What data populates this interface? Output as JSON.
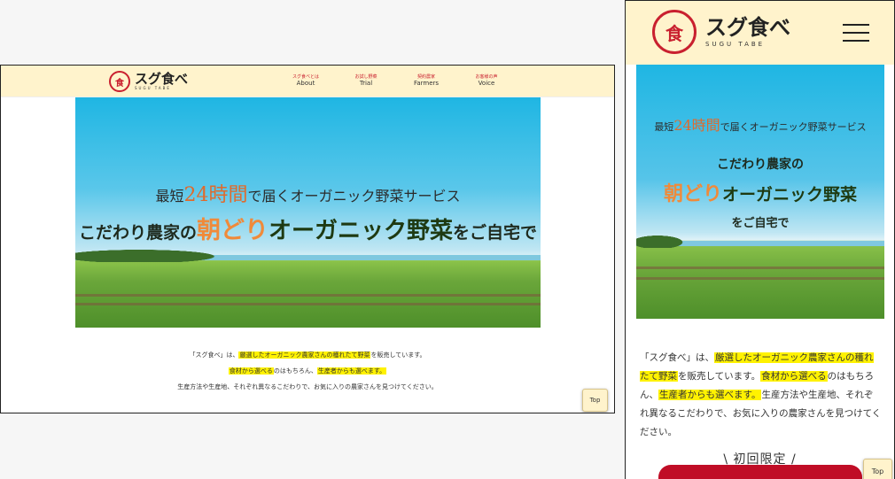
{
  "brand": {
    "mark": "食",
    "name": "スグ食べ",
    "name_en": "SUGU TABE",
    "accent": "#c9202f",
    "header_bg": "#fff3cc",
    "highlight": "#fff200"
  },
  "nav": {
    "items": [
      {
        "jp": "スグ食べとは",
        "en": "About"
      },
      {
        "jp": "お試し野菜",
        "en": "Trial"
      },
      {
        "jp": "契約農家",
        "en": "Farmers"
      },
      {
        "jp": "お客様の声",
        "en": "Voice"
      }
    ]
  },
  "hero": {
    "line1_pre": "最短",
    "line1_num": "24時間",
    "line1_post": "で届くオーガニック野菜サービス",
    "line2_pre": "こだわり農家の",
    "line2_hl": "朝どり",
    "line2_big": "オーガニック野菜",
    "line2_post": "をご自宅で"
  },
  "intro": {
    "p1_pre": "「スグ食べ」は、",
    "p1_hl": "厳選したオーガニック農家さんの穫れたて野菜",
    "p1_post": "を販売しています。",
    "p2_hl1": "食材から選べる",
    "p2_mid": "のはもちろん、",
    "p2_hl2": "生産者からも選べます。",
    "p3": "生産方法や生産地、それぞれ異なるこだわりで、お気に入りの農家さんを見つけてください。"
  },
  "mobile": {
    "limited": "\\ 初回限定 /"
  },
  "top_button": "Top",
  "icons": {
    "menu": "hamburger-menu-icon",
    "logo": "sugu-tabe-logo-icon"
  }
}
